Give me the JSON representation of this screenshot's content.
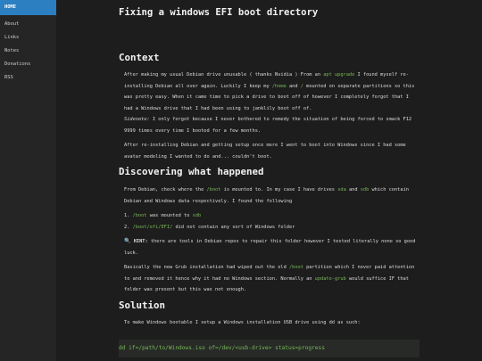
{
  "sidebar": {
    "items": [
      {
        "label": "HOME",
        "active": true
      },
      {
        "label": "About"
      },
      {
        "label": "Links"
      },
      {
        "label": "Notes"
      },
      {
        "label": "Donations"
      },
      {
        "label": "RSS"
      }
    ]
  },
  "title": "Fixing a windows EFI boot directory",
  "context": {
    "heading": "Context",
    "p1_a": "After making my usual Debian drive unusable ( thanks Nvidia ) From an ",
    "p1_code1": "apt upgrade",
    "p1_b": " I found myself re-installing Debian all over again. Luckily I keep my ",
    "p1_code2": "/home",
    "p1_c": " and ",
    "p1_code3": "/",
    "p1_d": " mounted on separate partitions so this was pretty easy. When it came time to pick a drive to boot off of however I completely forgot that I had a Windows drive that I had been using to janklily boot off of.",
    "p2_em": "Sidenote:",
    "p2_rest": " I only forgot because I never bothered to remedy the situation of being forced to smack F12 9999 times every time I booted for a few months.",
    "p3": "After re-installing Debian and getting setup once more I went to boot into Windows since I had some avatar modeling I wanted to do and... couldn't boot."
  },
  "discovering": {
    "heading": "Discovering what happened",
    "p1_a": "From Debian, check where the ",
    "p1_code1": "/boot",
    "p1_b": " is mounted to. In my case I have drives ",
    "p1_code2": "sda",
    "p1_c": " and ",
    "p1_code3": "sdb",
    "p1_d": " which contain Debian and Windows data respectively. I found the following",
    "list": [
      {
        "num": "1.",
        "code": "/boot",
        "text": " was mounted to ",
        "code2": "sdb"
      },
      {
        "num": "2.",
        "code": "/boot/efi/EFI/",
        "text": " did not contain any sort of Windows folder",
        "code2": ""
      }
    ],
    "hint_icon": "🔍",
    "hint_label": "HINT:",
    "hint_text": " there are tools in Debian repos to repair this folder however I tested literally none so good luck.",
    "p3_a": "Basically the new Grub installation had wiped out the old ",
    "p3_code1": "/boot",
    "p3_b": " partition which I never paid attention to and removed it   hence why it had no Windows section. Normally an ",
    "p3_code2": "update-grub",
    "p3_c": " would suffice IF that folder was present but this was not enough."
  },
  "solution": {
    "heading": "Solution",
    "p1": "To make Windows bootable I setup a Windows installation USB drive using dd as such:",
    "code": "dd if=/path/to/Windows.iso of=/dev/<usb-drive> status=progress"
  }
}
